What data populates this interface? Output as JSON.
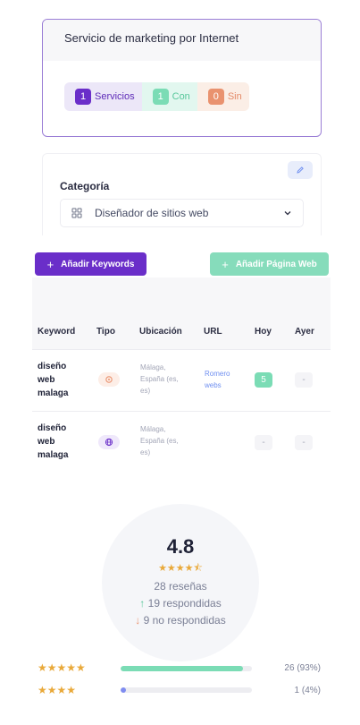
{
  "service": {
    "title": "Servicio de marketing por Internet",
    "stats": [
      {
        "count": "1",
        "label": "Servicios"
      },
      {
        "count": "1",
        "label": "Con"
      },
      {
        "count": "0",
        "label": "Sin"
      }
    ]
  },
  "category": {
    "label": "Categoría",
    "selected": "Diseñador de sitios web",
    "icons": {
      "edit": "pencil-icon",
      "grid": "grid-icon",
      "chevron": "chevron-down-icon"
    }
  },
  "keywords": {
    "add_keyword_label": "Añadir Keywords",
    "add_web_label": "Añadir Página Web",
    "columns": [
      "Keyword",
      "Tipo",
      "Ubicación",
      "URL",
      "Hoy",
      "Ayer"
    ],
    "rows": [
      {
        "keyword": "diseño web malaga",
        "tipo": "location-pin-icon",
        "ubicacion": "Málaga, España (es, es)",
        "url": "Romero webs",
        "hoy": "5",
        "ayer": "-"
      },
      {
        "keyword": "diseño web malaga",
        "tipo": "globe-icon",
        "ubicacion": "Málaga, España (es, es)",
        "url": "",
        "hoy": "-",
        "ayer": "-"
      }
    ]
  },
  "rating": {
    "score": "4.8",
    "stars": "★★★★⯪",
    "reviews": "28 reseñas",
    "answered": "19 respondidas",
    "unanswered": "9 no respondidas",
    "distribution": [
      {
        "stars": "★★★★★",
        "count": "26 (93%)",
        "fraction": 0.93,
        "color": "#7bdcb5"
      },
      {
        "stars": "★★★★",
        "count": "1 (4%)",
        "fraction": 0.04,
        "color": "#7f8cf0"
      }
    ]
  }
}
